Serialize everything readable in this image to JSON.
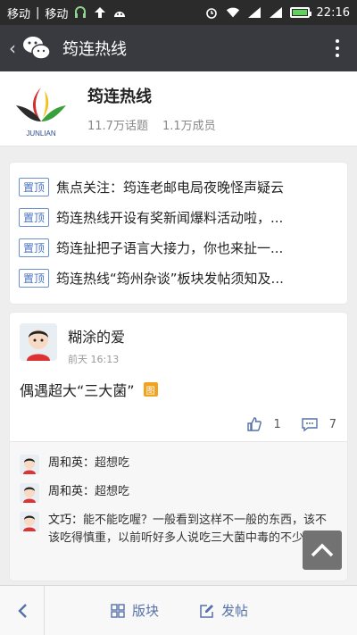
{
  "statusbar": {
    "carrier1": "移动",
    "separator": "|",
    "carrier2": "移动",
    "time": "22:16"
  },
  "topbar": {
    "title": "筠连热线"
  },
  "header": {
    "name": "筠连热线",
    "topics": "11.7万话题",
    "members": "1.1万成员",
    "logo_text": "JUNLIAN"
  },
  "pinned": {
    "items": [
      {
        "tag": "置顶",
        "text": "焦点关注：筠连老邮电局夜晚怪声疑云"
      },
      {
        "tag": "置顶",
        "text": "筠连热线开设有奖新闻爆料活动啦，..."
      },
      {
        "tag": "置顶",
        "text": "筠连扯把子语言大接力，你也来扯一..."
      },
      {
        "tag": "置顶",
        "text": "筠连热线“筠州杂谈”板块发帖须知及..."
      }
    ]
  },
  "post": {
    "author": "糊涂的爱",
    "time": "前天 16:13",
    "title": "偶遇超大“三大菌”",
    "img_badge": "图",
    "likes": "1",
    "comments_count": "7",
    "comments": [
      {
        "who": "周和英：",
        "text": "超想吃"
      },
      {
        "who": "周和英：",
        "text": "超想吃"
      },
      {
        "who": "文巧：",
        "text": "能不能吃喔？一般看到这样不一般的东西，该不该吃得慎重，以前听好多人说吃三大菌中毒的不少"
      }
    ]
  },
  "bottombar": {
    "boards": "版块",
    "post": "发帖"
  },
  "colors": {
    "accent": "#5571a8",
    "badge": "#f1a21f",
    "titlebar": "#393a3f"
  }
}
